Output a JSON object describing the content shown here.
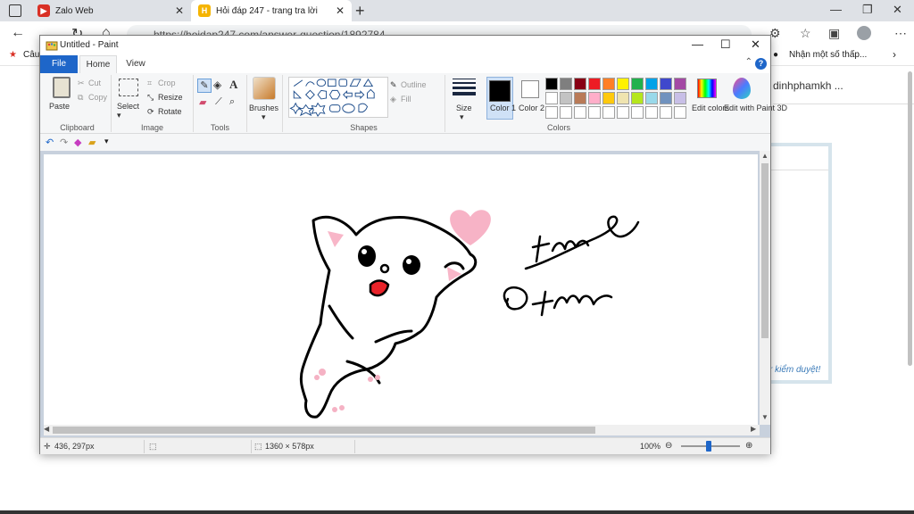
{
  "browser": {
    "tabs": [
      {
        "label": "Zalo Web",
        "active": false
      },
      {
        "label": "Hỏi đáp 247 - trang tra lời",
        "active": true
      }
    ],
    "url": "https://hoidap247.com/answer-question/1892784",
    "favorites": {
      "left_item": "Câu",
      "right_item": "Nhận một số thấp..."
    }
  },
  "webpage": {
    "username": "dinhphamkh ...",
    "note": "r kiểm duyệt!"
  },
  "paint": {
    "title": "Untitled - Paint",
    "tabs": {
      "file": "File",
      "home": "Home",
      "view": "View"
    },
    "clipboard": {
      "paste": "Paste",
      "cut": "Cut",
      "copy": "Copy",
      "label": "Clipboard"
    },
    "image": {
      "select": "Select",
      "crop": "Crop",
      "resize": "Resize",
      "rotate": "Rotate",
      "label": "Image"
    },
    "tools": {
      "label": "Tools",
      "text_glyph": "A"
    },
    "brushes": {
      "label": "Brushes"
    },
    "shapes": {
      "outline": "Outline",
      "fill": "Fill",
      "label": "Shapes"
    },
    "size": {
      "label": "Size"
    },
    "colors": {
      "color1_label": "Color 1",
      "color2_label": "Color 2",
      "edit_colors": "Edit colors",
      "edit_3d": "Edit with Paint 3D",
      "label": "Colors",
      "palette": [
        "#000000",
        "#7f7f7f",
        "#880015",
        "#ed1c24",
        "#ff7f27",
        "#fff200",
        "#22b14c",
        "#00a2e8",
        "#3f48cc",
        "#a349a4",
        "#ffffff",
        "#c3c3c3",
        "#b97a57",
        "#ffaec9",
        "#ffc90e",
        "#efe4b0",
        "#b5e61d",
        "#99d9ea",
        "#7092be",
        "#c8bfe7",
        "#ffffff",
        "#ffffff",
        "#ffffff",
        "#ffffff",
        "#ffffff",
        "#ffffff",
        "#ffffff",
        "#ffffff",
        "#ffffff",
        "#ffffff"
      ]
    },
    "status": {
      "cursor_pos": "436, 297px",
      "canvas_size": "1360 × 578px",
      "zoom": "100%"
    }
  }
}
